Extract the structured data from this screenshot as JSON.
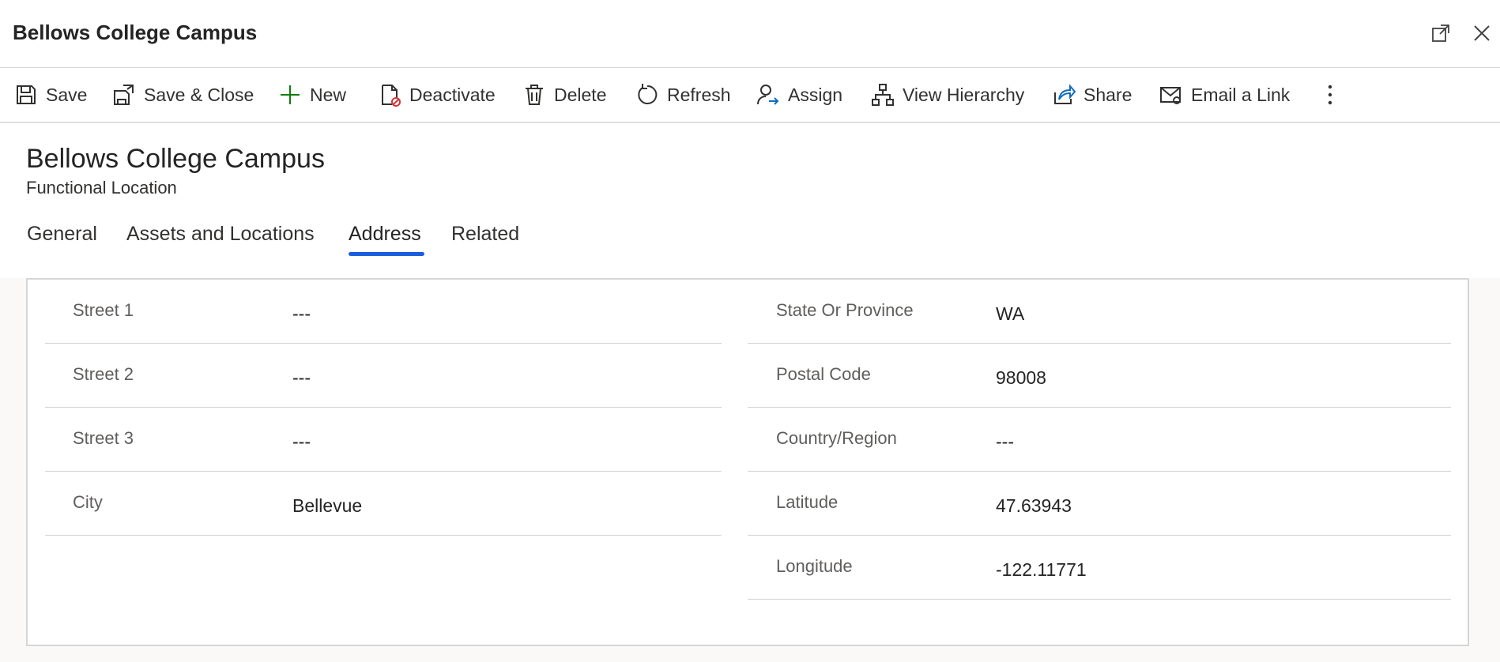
{
  "window": {
    "title": "Bellows College Campus",
    "pop_out_icon": "pop-out-icon",
    "close_icon": "close-icon"
  },
  "toolbar": {
    "items": [
      {
        "label": "Save",
        "icon": "save-icon"
      },
      {
        "label": "Save & Close",
        "icon": "save-close-icon"
      },
      {
        "label": "New",
        "icon": "plus-icon"
      },
      {
        "label": "Deactivate",
        "icon": "deactivate-icon"
      },
      {
        "label": "Delete",
        "icon": "trash-icon"
      },
      {
        "label": "Refresh",
        "icon": "refresh-icon"
      },
      {
        "label": "Assign",
        "icon": "assign-icon"
      },
      {
        "label": "View Hierarchy",
        "icon": "hierarchy-icon"
      },
      {
        "label": "Share",
        "icon": "share-icon"
      },
      {
        "label": "Email a Link",
        "icon": "email-icon"
      }
    ],
    "more_icon": "more-vertical-icon"
  },
  "header": {
    "title": "Bellows College Campus",
    "entity_type": "Functional Location"
  },
  "tabs": [
    {
      "label": "General",
      "active": false
    },
    {
      "label": "Assets and Locations",
      "active": false
    },
    {
      "label": "Address",
      "active": true
    },
    {
      "label": "Related",
      "active": false
    }
  ],
  "address": {
    "left": [
      {
        "label": "Street 1",
        "value": "---"
      },
      {
        "label": "Street 2",
        "value": "---"
      },
      {
        "label": "Street 3",
        "value": "---"
      },
      {
        "label": "City",
        "value": "Bellevue"
      }
    ],
    "right": [
      {
        "label": "State Or Province",
        "value": "WA"
      },
      {
        "label": "Postal Code",
        "value": "98008"
      },
      {
        "label": "Country/Region",
        "value": "---"
      },
      {
        "label": "Latitude",
        "value": "47.63943"
      },
      {
        "label": "Longitude",
        "value": "-122.11771"
      }
    ]
  },
  "colors": {
    "accent": "#1a5edc",
    "new_icon": "#107c10",
    "deactivate_badge": "#d13438",
    "assign_arrow": "#0f6cbd"
  }
}
